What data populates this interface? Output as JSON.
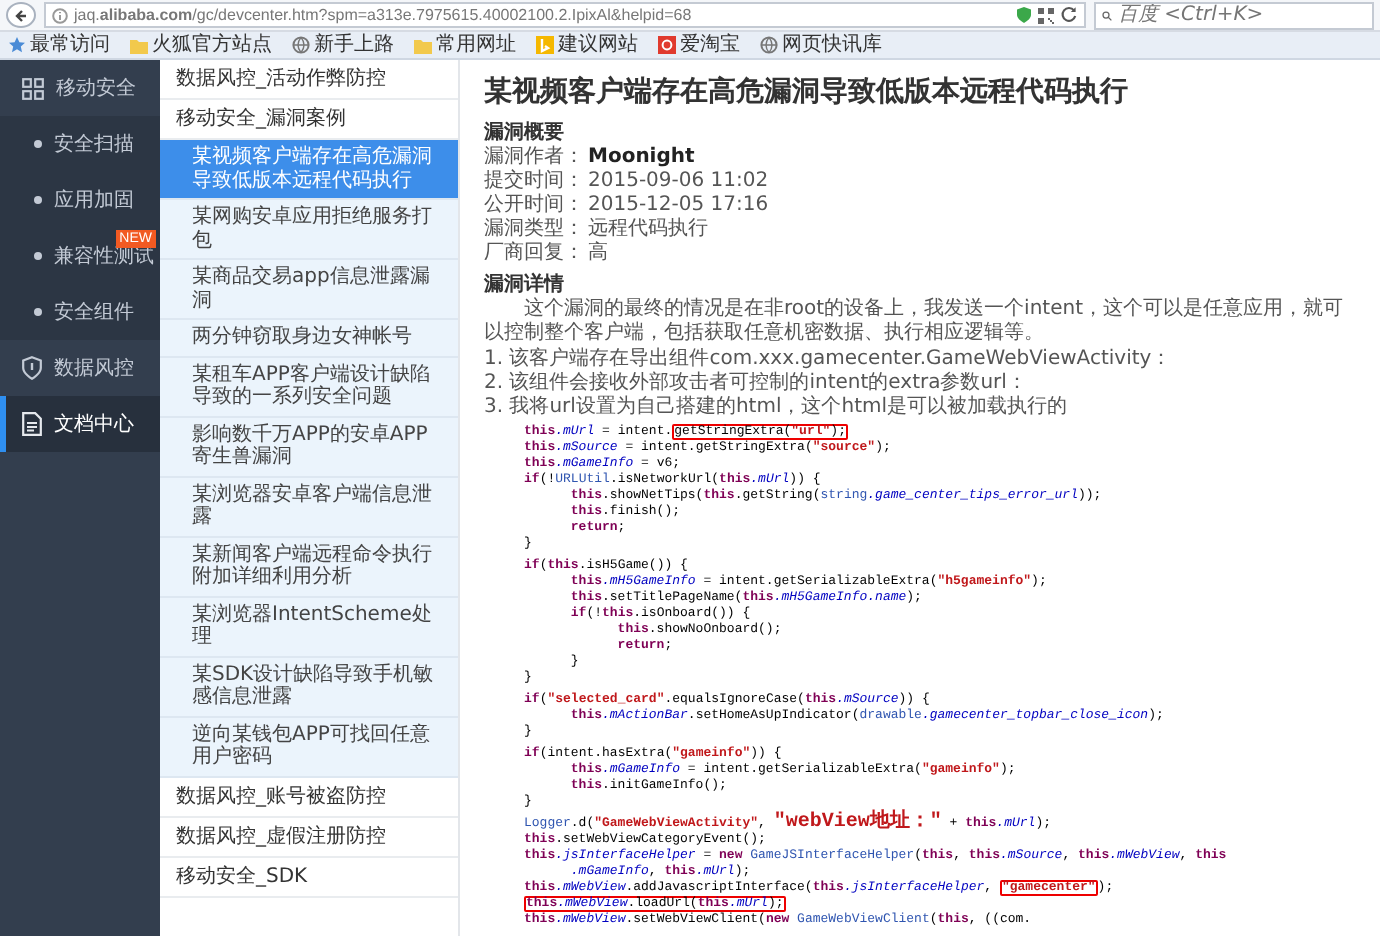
{
  "browser": {
    "url": "jaq.**alibaba.com**/gc/devcenter.htm?spm=a313e.7975615.40002100.2.IpixAl&helpid=68",
    "search": {
      "placeholder": "百度 <Ctrl+K>"
    },
    "bookmarks": [
      {
        "label": "最常访问"
      },
      {
        "label": "火狐官方站点"
      },
      {
        "label": "新手上路"
      },
      {
        "label": "常用网址"
      },
      {
        "label": "建议网站"
      },
      {
        "label": "爱淘宝"
      },
      {
        "label": "网页快讯库"
      }
    ]
  },
  "sidebar": {
    "items": [
      {
        "kind": "section",
        "label": "移动安全",
        "selected": false
      },
      {
        "kind": "sub",
        "label": "安全扫描",
        "selected": false
      },
      {
        "kind": "sub",
        "label": "应用加固",
        "selected": false
      },
      {
        "kind": "sub",
        "label": "兼容性测试",
        "selected": false,
        "badge": "NEW"
      },
      {
        "kind": "sub",
        "label": "安全组件",
        "selected": false
      },
      {
        "kind": "section",
        "label": "数据风控",
        "selected": false
      },
      {
        "kind": "section",
        "label": "文档中心",
        "selected": true
      }
    ]
  },
  "articles": [
    {
      "title": "数据风控_活动作弊防控"
    },
    {
      "title": "移动安全_漏洞案例",
      "children": [
        {
          "title": "某视频客户端存在高危漏洞导致低版本远程代码执行",
          "selected": true
        },
        {
          "title": "某网购安卓应用拒绝服务打包",
          "selected": false
        },
        {
          "title": "某商品交易app信息泄露漏洞",
          "selected": false
        },
        {
          "title": "两分钟窃取身边女神帐号",
          "selected": false
        },
        {
          "title": "某租车APP客户端设计缺陷导致的一系列安全问题",
          "selected": false
        },
        {
          "title": "影响数千万APP的安卓APP寄生兽漏洞",
          "selected": false
        },
        {
          "title": "某浏览器安卓客户端信息泄露",
          "selected": false
        },
        {
          "title": "某新闻客户端远程命令执行附加详细利用分析",
          "selected": false
        },
        {
          "title": "某浏览器IntentScheme处理",
          "selected": false
        },
        {
          "title": "某SDK设计缺陷导致手机敏感信息泄露",
          "selected": false
        },
        {
          "title": "逆向某钱包APP可找回任意用户密码",
          "selected": false
        }
      ]
    },
    {
      "title": "数据风控_账号被盗防控"
    },
    {
      "title": "数据风控_虚假注册防控"
    },
    {
      "title": "移动安全_SDK"
    }
  ],
  "article": {
    "title": "某视频客户端存在高危漏洞导致低版本远程代码执行",
    "summary_heading": "漏洞概要",
    "meta": [
      {
        "label": "漏洞作者：",
        "value": "Moonight",
        "bold": true
      },
      {
        "label": "提交时间：",
        "value": "2015-09-06 11:02",
        "bold": false
      },
      {
        "label": "公开时间：",
        "value": "2015-12-05 17:16",
        "bold": false
      },
      {
        "label": "漏洞类型：",
        "value": "远程代码执行",
        "bold": false
      },
      {
        "label": "厂商回复：",
        "value": "高",
        "bold": false
      }
    ],
    "details_heading": "漏洞详情",
    "intro": "这个漏洞的最终的情况是在非root的设备上，我发送一个intent，这个可以是任意应用，就可以控制整个客户端，包括获取任意机密数据、执行相应逻辑等。",
    "steps": [
      "1. 该客户端存在导出组件com.xxx.gamecenter.GameWebViewActivity：",
      "2. 该组件会接收外部攻击者可控制的intent的extra参数url：",
      "3. 我将url设置为自己搭建的html，这个html是可以被加载执行的"
    ],
    "code": [
      {
        "kind": "code",
        "tokens": [
          {
            "kind": "keyword",
            "text": "this"
          },
          {
            "kind": "field",
            "text": ".mUrl"
          },
          {
            "kind": "plain",
            "text": " = intent."
          },
          {
            "kind": "plain",
            "text": "getStringExtra(",
            "boxed": true
          },
          {
            "kind": "string",
            "text": "\"url\"",
            "boxed": true
          },
          {
            "kind": "plain",
            "text": ");",
            "boxed": true
          }
        ]
      },
      {
        "kind": "code",
        "tokens": [
          {
            "kind": "keyword",
            "text": "this"
          },
          {
            "kind": "field",
            "text": ".mSource"
          },
          {
            "kind": "plain",
            "text": " = intent.getStringExtra("
          },
          {
            "kind": "string",
            "text": "\"source\""
          },
          {
            "kind": "plain",
            "text": ");"
          }
        ]
      },
      {
        "kind": "code",
        "tokens": [
          {
            "kind": "keyword",
            "text": "this"
          },
          {
            "kind": "field",
            "text": ".mGameInfo"
          },
          {
            "kind": "plain",
            "text": " = v6;"
          }
        ]
      },
      {
        "kind": "code",
        "tokens": [
          {
            "kind": "keyword",
            "text": "if"
          },
          {
            "kind": "plain",
            "text": "(!"
          },
          {
            "kind": "type",
            "text": "URLUtil"
          },
          {
            "kind": "plain",
            "text": ".isNetworkUrl("
          },
          {
            "kind": "keyword",
            "text": "this"
          },
          {
            "kind": "field",
            "text": ".mUrl"
          },
          {
            "kind": "plain",
            "text": ")) {"
          }
        ],
        "children": [
          {
            "kind": "code",
            "tokens": [
              {
                "kind": "keyword",
                "text": "this"
              },
              {
                "kind": "plain",
                "text": ".showNetTips("
              },
              {
                "kind": "keyword",
                "text": "this"
              },
              {
                "kind": "plain",
                "text": ".getString("
              },
              {
                "kind": "type",
                "text": "string"
              },
              {
                "kind": "field",
                "text": ".game_center_tips_error_url"
              },
              {
                "kind": "plain",
                "text": "));"
              }
            ]
          },
          {
            "kind": "code",
            "tokens": [
              {
                "kind": "keyword",
                "text": "this"
              },
              {
                "kind": "plain",
                "text": ".finish();"
              }
            ]
          },
          {
            "kind": "code",
            "tokens": [
              {
                "kind": "keyword",
                "text": "return"
              },
              {
                "kind": "plain",
                "text": ";"
              }
            ]
          }
        ]
      },
      {
        "kind": "code",
        "tokens": [
          {
            "kind": "plain",
            "text": "}"
          }
        ]
      },
      {
        "kind": "blank"
      },
      {
        "kind": "code",
        "tokens": [
          {
            "kind": "keyword",
            "text": "if"
          },
          {
            "kind": "plain",
            "text": "("
          },
          {
            "kind": "keyword",
            "text": "this"
          },
          {
            "kind": "plain",
            "text": ".isH5Game()) {"
          }
        ],
        "children": [
          {
            "kind": "code",
            "tokens": [
              {
                "kind": "keyword",
                "text": "this"
              },
              {
                "kind": "field",
                "text": ".mH5GameInfo"
              },
              {
                "kind": "plain",
                "text": " = intent.getSerializableExtra("
              },
              {
                "kind": "string",
                "text": "\"h5gameinfo\""
              },
              {
                "kind": "plain",
                "text": ");"
              }
            ]
          },
          {
            "kind": "code",
            "tokens": [
              {
                "kind": "keyword",
                "text": "this"
              },
              {
                "kind": "plain",
                "text": ".setTitlePageName("
              },
              {
                "kind": "keyword",
                "text": "this"
              },
              {
                "kind": "field",
                "text": ".mH5GameInfo"
              },
              {
                "kind": "field",
                "text": ".name"
              },
              {
                "kind": "plain",
                "text": ");"
              }
            ]
          },
          {
            "kind": "code",
            "tokens": [
              {
                "kind": "keyword",
                "text": "if"
              },
              {
                "kind": "plain",
                "text": "(!"
              },
              {
                "kind": "keyword",
                "text": "this"
              },
              {
                "kind": "plain",
                "text": ".isOnboard()) {"
              }
            ],
            "children": [
              {
                "kind": "code",
                "tokens": [
                  {
                    "kind": "keyword",
                    "text": "this"
                  },
                  {
                    "kind": "plain",
                    "text": ".showNoOnboard();"
                  }
                ]
              },
              {
                "kind": "code",
                "tokens": [
                  {
                    "kind": "keyword",
                    "text": "return"
                  },
                  {
                    "kind": "plain",
                    "text": ";"
                  }
                ]
              }
            ]
          },
          {
            "kind": "code",
            "tokens": [
              {
                "kind": "plain",
                "text": "}"
              }
            ]
          }
        ]
      },
      {
        "kind": "code",
        "tokens": [
          {
            "kind": "plain",
            "text": "}"
          }
        ]
      },
      {
        "kind": "blank"
      },
      {
        "kind": "code",
        "tokens": [
          {
            "kind": "keyword",
            "text": "if"
          },
          {
            "kind": "plain",
            "text": "("
          },
          {
            "kind": "string",
            "text": "\"selected_card\""
          },
          {
            "kind": "plain",
            "text": ".equalsIgnoreCase("
          },
          {
            "kind": "keyword",
            "text": "this"
          },
          {
            "kind": "field",
            "text": ".mSource"
          },
          {
            "kind": "plain",
            "text": ")) {"
          }
        ],
        "children": [
          {
            "kind": "code",
            "tokens": [
              {
                "kind": "keyword",
                "text": "this"
              },
              {
                "kind": "field",
                "text": ".mActionBar"
              },
              {
                "kind": "plain",
                "text": ".setHomeAsUpIndicator("
              },
              {
                "kind": "type",
                "text": "drawable"
              },
              {
                "kind": "field",
                "text": ".gamecenter_topbar_close_icon"
              },
              {
                "kind": "plain",
                "text": ");"
              }
            ]
          }
        ]
      },
      {
        "kind": "code",
        "tokens": [
          {
            "kind": "plain",
            "text": "}"
          }
        ]
      },
      {
        "kind": "blank"
      },
      {
        "kind": "code",
        "tokens": [
          {
            "kind": "keyword",
            "text": "if"
          },
          {
            "kind": "plain",
            "text": "(intent.hasExtra("
          },
          {
            "kind": "string",
            "text": "\"gameinfo\""
          },
          {
            "kind": "plain",
            "text": ")) {"
          }
        ],
        "children": [
          {
            "kind": "code",
            "tokens": [
              {
                "kind": "keyword",
                "text": "this"
              },
              {
                "kind": "field",
                "text": ".mGameInfo"
              },
              {
                "kind": "plain",
                "text": " = intent.getSerializableExtra("
              },
              {
                "kind": "string",
                "text": "\"gameinfo\""
              },
              {
                "kind": "plain",
                "text": ");"
              }
            ]
          },
          {
            "kind": "code",
            "tokens": [
              {
                "kind": "keyword",
                "text": "this"
              },
              {
                "kind": "plain",
                "text": ".initGameInfo();"
              }
            ]
          }
        ]
      },
      {
        "kind": "code",
        "tokens": [
          {
            "kind": "plain",
            "text": "}"
          }
        ]
      },
      {
        "kind": "blank"
      },
      {
        "kind": "code",
        "tokens": [
          {
            "kind": "type",
            "text": "Logger"
          },
          {
            "kind": "plain",
            "text": ".d("
          },
          {
            "kind": "string",
            "text": "\"GameWebViewActivity\""
          },
          {
            "kind": "plain",
            "text": ", "
          },
          {
            "kind": "string",
            "text": "\"webView地址：\""
          },
          {
            "kind": "plain",
            "text": " + "
          },
          {
            "kind": "keyword",
            "text": "this"
          },
          {
            "kind": "field",
            "text": ".mUrl"
          },
          {
            "kind": "plain",
            "text": ");"
          }
        ]
      },
      {
        "kind": "code",
        "tokens": [
          {
            "kind": "keyword",
            "text": "this"
          },
          {
            "kind": "plain",
            "text": ".setWebViewCategoryEvent();"
          }
        ]
      },
      {
        "kind": "code",
        "tokens": [
          {
            "kind": "keyword",
            "text": "this"
          },
          {
            "kind": "field",
            "text": ".jsInterfaceHelper"
          },
          {
            "kind": "plain",
            "text": " = "
          },
          {
            "kind": "keyword",
            "text": "new"
          },
          {
            "kind": "type",
            "text": " GameJSInterfaceHelper"
          },
          {
            "kind": "plain",
            "text": "("
          },
          {
            "kind": "keyword",
            "text": "this"
          },
          {
            "kind": "plain",
            "text": ", "
          },
          {
            "kind": "keyword",
            "text": "this"
          },
          {
            "kind": "field",
            "text": ".mSource"
          },
          {
            "kind": "plain",
            "text": ", "
          },
          {
            "kind": "keyword",
            "text": "this"
          },
          {
            "kind": "field",
            "text": ".mWebView"
          },
          {
            "kind": "plain",
            "text": ", "
          },
          {
            "kind": "keyword",
            "text": "this"
          }
        ],
        "children": [
          {
            "kind": "code",
            "tokens": [
              {
                "kind": "field",
                "text": ".mGameInfo"
              },
              {
                "kind": "plain",
                "text": ", "
              },
              {
                "kind": "keyword",
                "text": "this"
              },
              {
                "kind": "field",
                "text": ".mUrl"
              },
              {
                "kind": "plain",
                "text": ");"
              }
            ]
          }
        ]
      },
      {
        "kind": "code",
        "tokens": [
          {
            "kind": "keyword",
            "text": "this"
          },
          {
            "kind": "field",
            "text": ".mWebView"
          },
          {
            "kind": "plain",
            "text": ".addJavascriptInterface("
          },
          {
            "kind": "keyword",
            "text": "this"
          },
          {
            "kind": "field",
            "text": ".jsInterfaceHelper"
          },
          {
            "kind": "plain",
            "text": ", "
          },
          {
            "kind": "string",
            "text": "\"gamecenter\"",
            "boxed": true
          },
          {
            "kind": "plain",
            "text": ");"
          }
        ]
      },
      {
        "kind": "code",
        "tokens": [
          {
            "kind": "keyword",
            "text": "this",
            "boxed": true
          },
          {
            "kind": "field",
            "text": ".mWebView",
            "boxed": true
          },
          {
            "kind": "plain",
            "text": ".loadUrl(",
            "boxed": true
          },
          {
            "kind": "keyword",
            "text": "this",
            "boxed": true
          },
          {
            "kind": "field",
            "text": ".mUrl",
            "boxed": true
          },
          {
            "kind": "plain",
            "text": ");",
            "boxed": true
          }
        ]
      },
      {
        "kind": "code",
        "tokens": [
          {
            "kind": "keyword",
            "text": "this"
          },
          {
            "kind": "field",
            "text": ".mWebView"
          },
          {
            "kind": "plain",
            "text": ".setWebViewClient("
          },
          {
            "kind": "keyword",
            "text": "new"
          },
          {
            "kind": "type",
            "text": " GameWebViewClient"
          },
          {
            "kind": "plain",
            "text": "("
          },
          {
            "kind": "keyword",
            "text": "this"
          },
          {
            "kind": "plain",
            "text": ", ((com."
          }
        ]
      }
    ]
  }
}
